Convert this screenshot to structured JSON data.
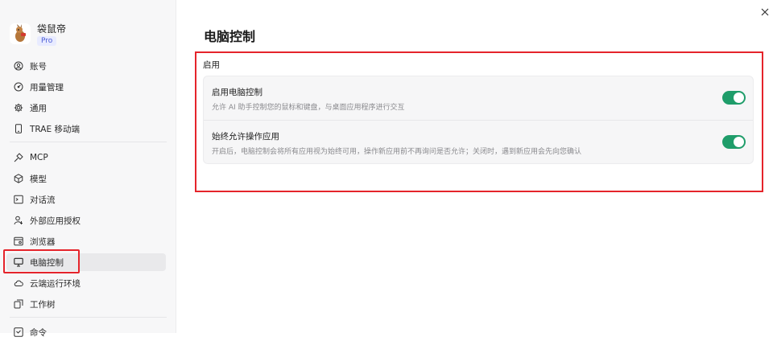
{
  "window": {
    "close_icon": "close-icon"
  },
  "profile": {
    "name": "袋鼠帝",
    "badge": "Pro"
  },
  "sidebar": {
    "items": [
      {
        "id": "account",
        "label": "账号",
        "icon": "user-circle-icon"
      },
      {
        "id": "usage",
        "label": "用量管理",
        "icon": "gauge-icon"
      },
      {
        "id": "general",
        "label": "通用",
        "icon": "gear-icon"
      },
      {
        "id": "mobile",
        "label": "TRAE 移动端",
        "icon": "phone-icon"
      },
      {
        "id": "mcp",
        "label": "MCP",
        "icon": "plug-icon"
      },
      {
        "id": "model",
        "label": "模型",
        "icon": "cube-icon"
      },
      {
        "id": "dialog-flow",
        "label": "对话流",
        "icon": "terminal-icon"
      },
      {
        "id": "external-auth",
        "label": "外部应用授权",
        "icon": "user-key-icon"
      },
      {
        "id": "browser",
        "label": "浏览器",
        "icon": "browser-icon"
      },
      {
        "id": "computer-control",
        "label": "电脑控制",
        "icon": "monitor-icon",
        "active": true
      },
      {
        "id": "cloud-env",
        "label": "云端运行环境",
        "icon": "cloud-icon"
      },
      {
        "id": "worktree",
        "label": "工作树",
        "icon": "worktree-icon"
      },
      {
        "id": "commands",
        "label": "命令",
        "icon": "command-icon"
      }
    ]
  },
  "main": {
    "title": "电脑控制",
    "section_title": "启用",
    "settings": [
      {
        "title": "启用电脑控制",
        "description": "允许 AI 助手控制您的鼠标和键盘，与桌面应用程序进行交互",
        "enabled": true
      },
      {
        "title": "始终允许操作应用",
        "description": "开启后，电脑控制会将所有应用视为始终可用，操作新应用前不再询问是否允许；关闭时，遇到新应用会先向您确认",
        "enabled": true
      }
    ]
  },
  "colors": {
    "toggle_on": "#1f9d6a",
    "highlight": "#e5242b",
    "sidebar_bg": "#f7f7f8",
    "pro_badge_text": "#4b5cd6"
  }
}
